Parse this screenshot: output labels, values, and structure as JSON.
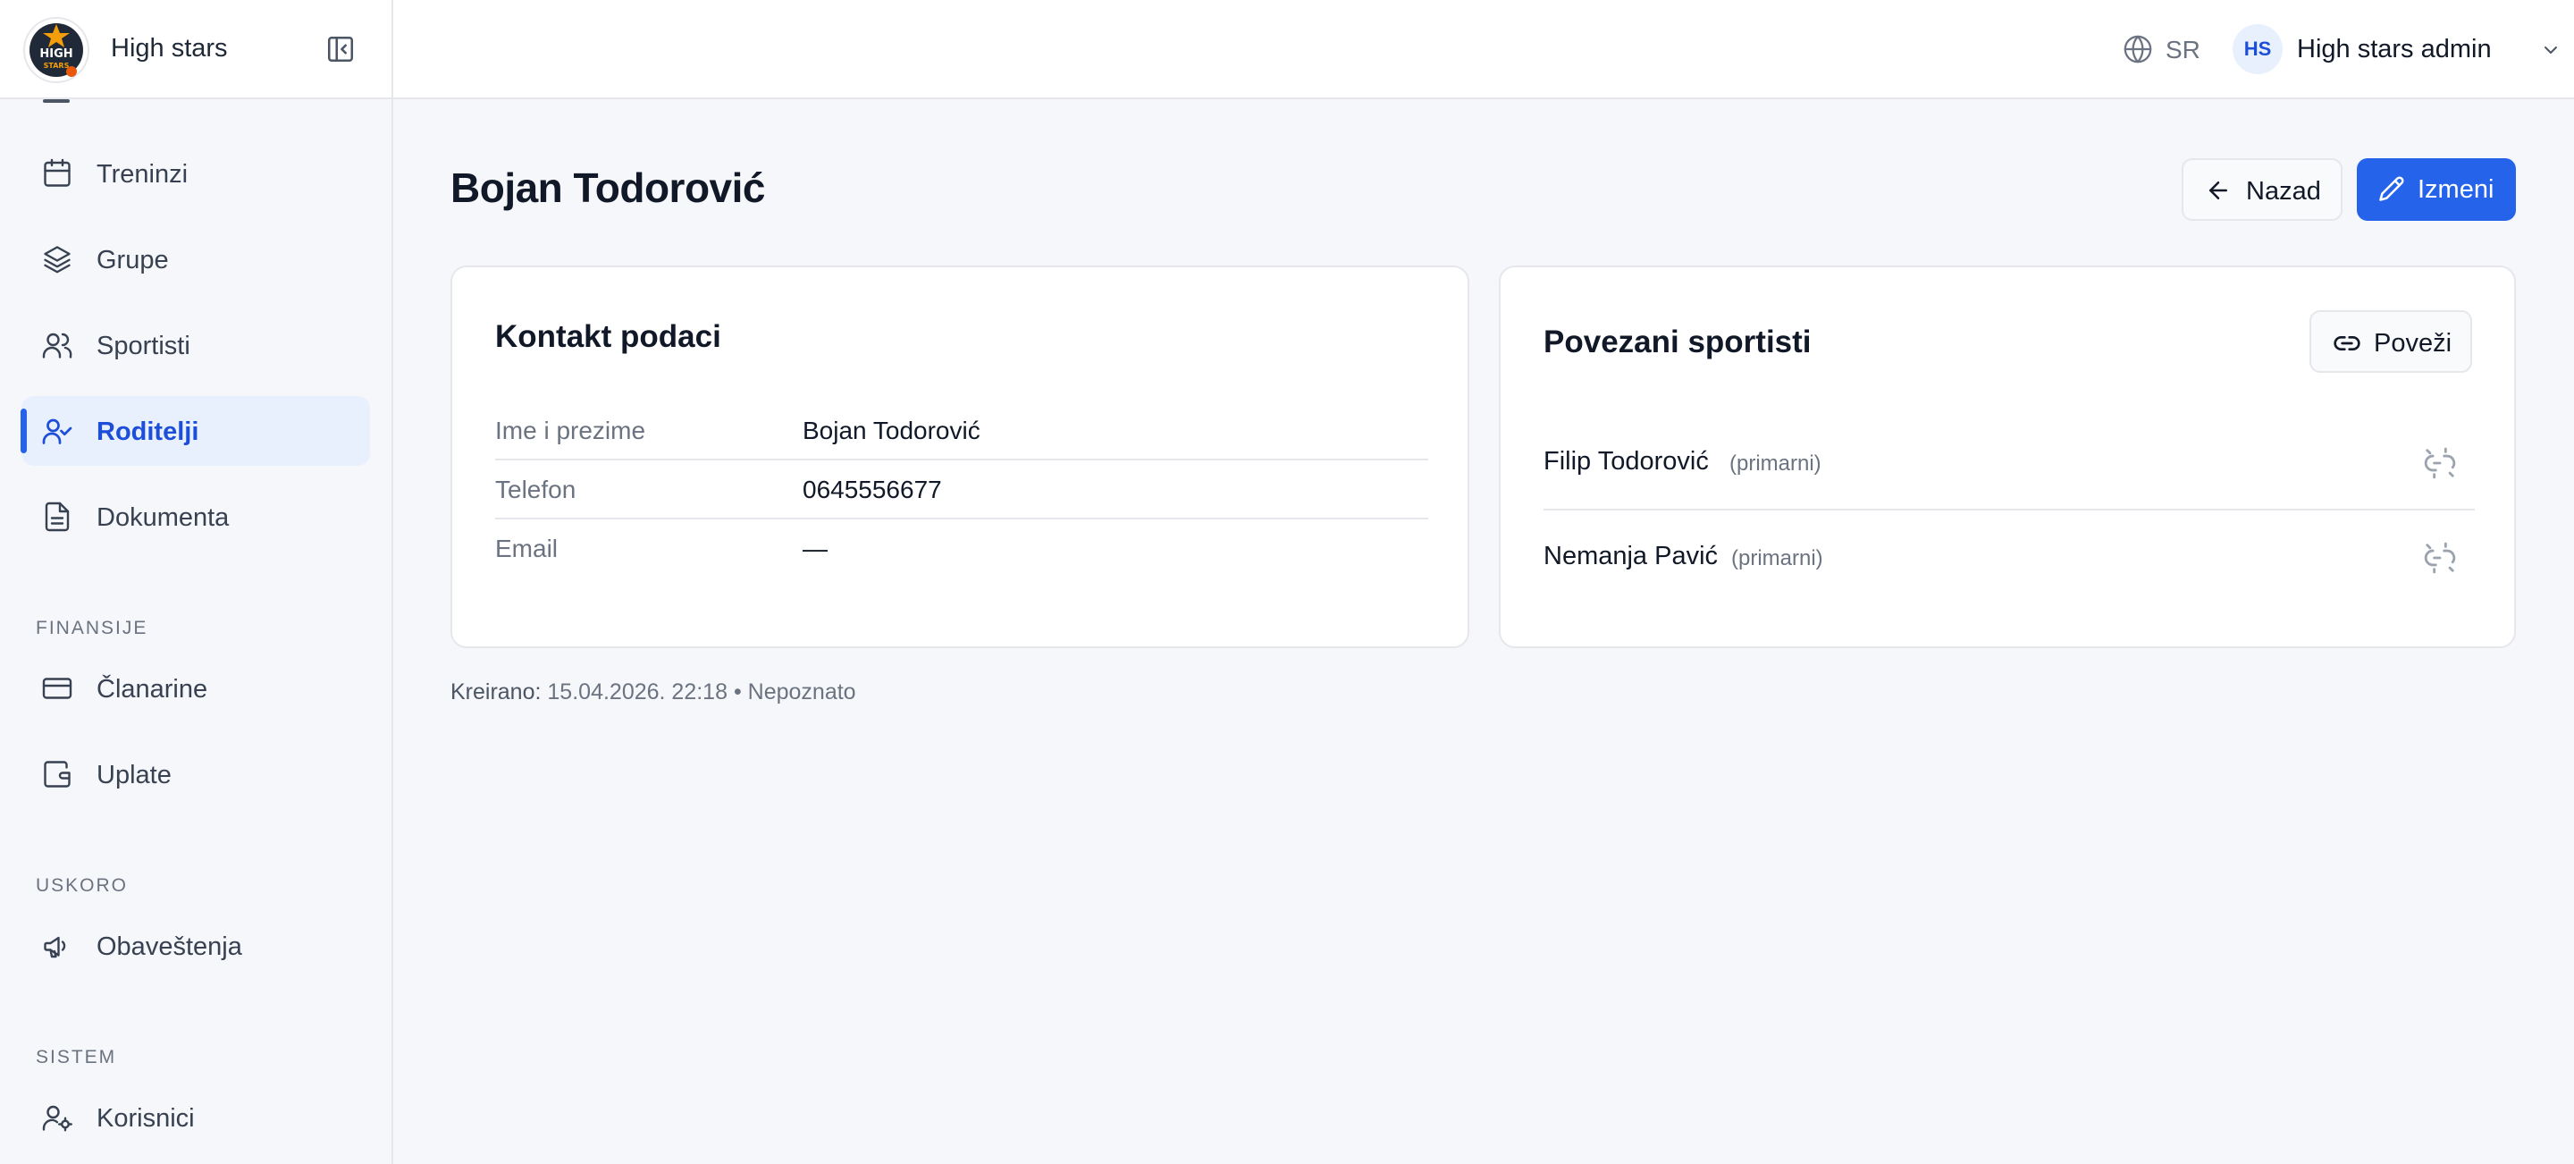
{
  "brand": {
    "name": "High stars",
    "logo_text_top": "HIGH",
    "logo_text_bottom": "STARS"
  },
  "sidebar": {
    "items": [
      {
        "label": "Treninzi",
        "icon": "calendar-icon"
      },
      {
        "label": "Grupe",
        "icon": "layers-icon"
      },
      {
        "label": "Sportisti",
        "icon": "users-icon"
      },
      {
        "label": "Roditelji",
        "icon": "user-check-icon",
        "active": true
      },
      {
        "label": "Dokumenta",
        "icon": "file-text-icon"
      },
      {
        "label": "Članarine",
        "icon": "credit-card-icon"
      },
      {
        "label": "Uplate",
        "icon": "wallet-icon"
      },
      {
        "label": "Obaveštenja",
        "icon": "megaphone-icon"
      },
      {
        "label": "Korisnici",
        "icon": "user-cog-icon"
      }
    ],
    "sections": {
      "finance": "FINANSIJE",
      "soon": "USKORO",
      "system": "SISTEM"
    }
  },
  "header": {
    "language": "SR",
    "user": {
      "initials": "HS",
      "name": "High stars admin"
    }
  },
  "page": {
    "title": "Bojan Todorović",
    "back_label": "Nazad",
    "edit_label": "Izmeni"
  },
  "contact": {
    "title": "Kontakt podaci",
    "rows": [
      {
        "key": "Ime i prezime",
        "value": "Bojan Todorović"
      },
      {
        "key": "Telefon",
        "value": "0645556677"
      },
      {
        "key": "Email",
        "value": "—"
      }
    ]
  },
  "athletes": {
    "title": "Povezani sportisti",
    "link_label": "Poveži",
    "items": [
      {
        "name": "Filip Todorović",
        "tag": "(primarni)"
      },
      {
        "name": "Nemanja Pavić",
        "tag": "(primarni)"
      }
    ]
  },
  "meta": {
    "created_label": "Kreirano:",
    "created_value": "15.04.2026. 22:18",
    "separator": "•",
    "author": "Nepoznato"
  },
  "colors": {
    "accent": "#2563eb",
    "active_bg": "#e8f0fe",
    "border": "#e5e7eb",
    "background": "#f5f7fa"
  }
}
